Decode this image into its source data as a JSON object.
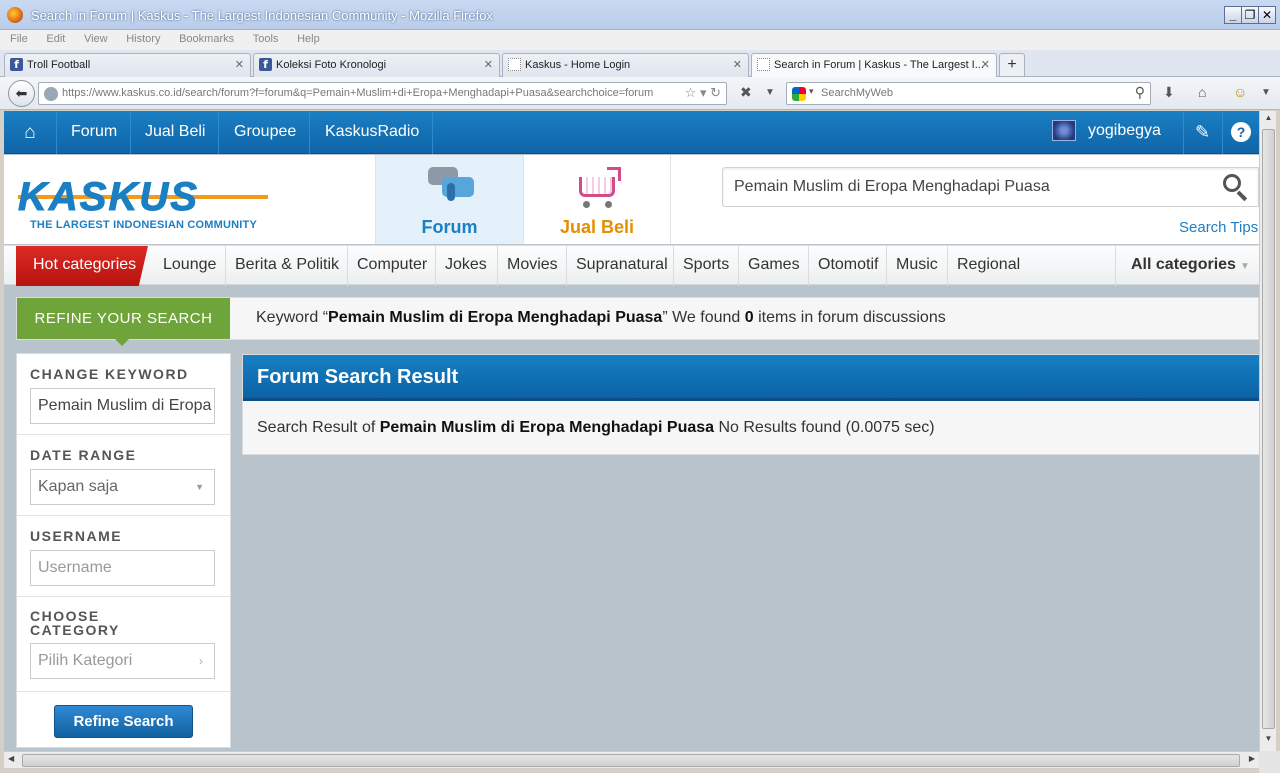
{
  "browser": {
    "window_title": "Search in Forum | Kaskus - The Largest Indonesian Community - Mozilla Firefox",
    "menu": [
      "File",
      "Edit",
      "View",
      "History",
      "Bookmarks",
      "Tools",
      "Help"
    ],
    "tabs": [
      {
        "label": "Troll Football",
        "icon": "facebook-icon",
        "active": false
      },
      {
        "label": "Koleksi Foto Kronologi",
        "icon": "facebook-icon",
        "active": false
      },
      {
        "label": "Kaskus - Home Login",
        "icon": "blank-page-icon",
        "active": false
      },
      {
        "label": "Search in Forum | Kaskus - The Largest I...",
        "icon": "blank-page-icon",
        "active": true
      }
    ],
    "new_tab": "+",
    "url": "https://www.kaskus.co.id/search/forum?f=forum&q=Pemain+Muslim+di+Eropa+Menghadapi+Puasa&searchchoice=forum",
    "search_engine_placeholder": "SearchMyWeb"
  },
  "topbar": {
    "links": [
      "Forum",
      "Jual Beli",
      "Groupee",
      "KaskusRadio"
    ],
    "username": "yogibegya",
    "help_label": "?"
  },
  "header": {
    "logo_text": "KASKUS",
    "tagline": "THE LARGEST INDONESIAN COMMUNITY",
    "nav": [
      {
        "label": "Forum",
        "active": true
      },
      {
        "label": "Jual Beli",
        "active": false
      }
    ],
    "search_value": "Pemain Muslim di Eropa Menghadapi Puasa",
    "search_tips": "Search Tips"
  },
  "categories": {
    "hot_label": "Hot categories",
    "items": [
      "Lounge",
      "Berita & Politik",
      "Computer",
      "Jokes",
      "Movies",
      "Supranatural",
      "Sports",
      "Games",
      "Otomotif",
      "Music",
      "Regional"
    ],
    "all_label": "All categories"
  },
  "refine": {
    "button_label": "REFINE YOUR SEARCH",
    "keyword_prefix": "Keyword “",
    "keyword": "Pemain Muslim di Eropa Menghadapi Puasa",
    "keyword_mid": "” We found ",
    "count": "0",
    "keyword_suffix": " items in forum discussions"
  },
  "sidebar": {
    "change_keyword_label": "CHANGE KEYWORD",
    "keyword_value": "Pemain Muslim di Eropa Menghadapi Puasa",
    "date_range_label": "DATE RANGE",
    "date_range_value": "Kapan saja",
    "username_label": "USERNAME",
    "username_placeholder": "Username",
    "category_label_1": "CHOOSE",
    "category_label_2": "CATEGORY",
    "category_placeholder": "Pilih Kategori",
    "refine_button": "Refine Search"
  },
  "results": {
    "title": "Forum Search Result",
    "prefix": "Search Result of ",
    "query": "Pemain Muslim di Eropa Menghadapi Puasa",
    "suffix": " No Results found (0.0075 sec)"
  }
}
